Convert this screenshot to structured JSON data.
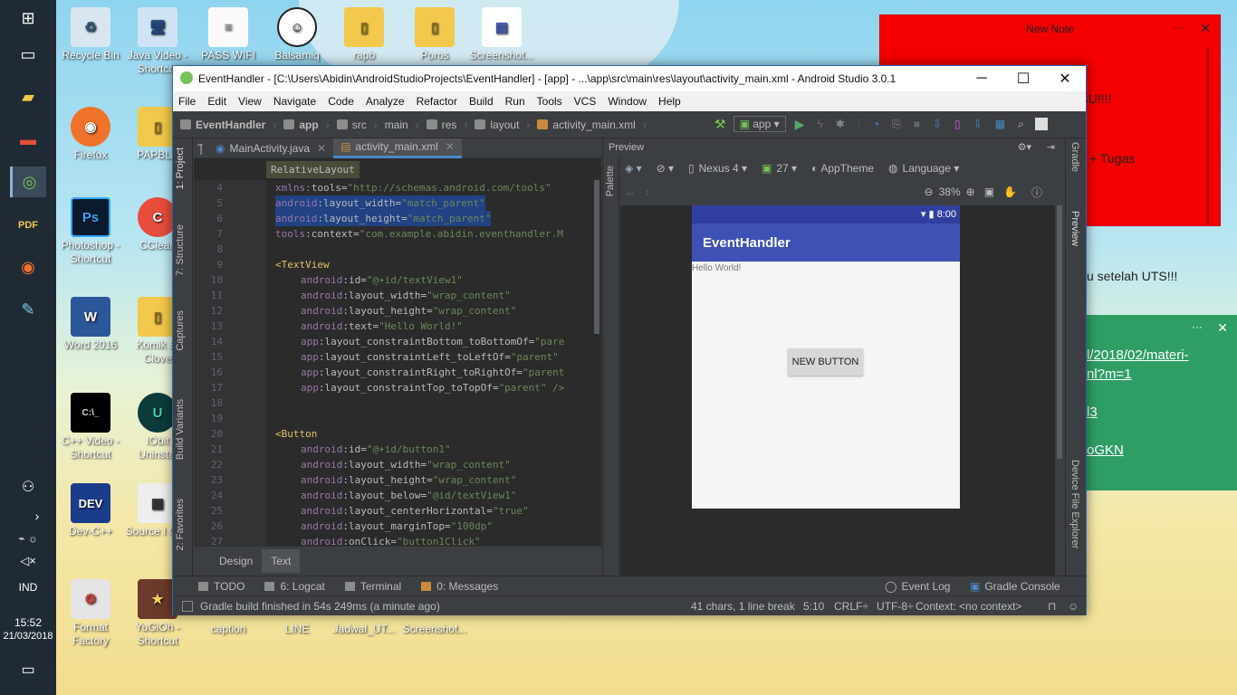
{
  "desktop": {
    "icons": [
      {
        "label": "Recycle Bin"
      },
      {
        "label": "Java Video - Shortcut"
      },
      {
        "label": "PASS WIFI"
      },
      {
        "label": "Balsamiq"
      },
      {
        "label": "rapb"
      },
      {
        "label": "Poros"
      },
      {
        "label": "Screenshot..."
      },
      {
        "label": "Firefox"
      },
      {
        "label": "PAPBLA"
      },
      {
        "label": "Photoshop - Shortcut"
      },
      {
        "label": "CClean"
      },
      {
        "label": "Word 2016"
      },
      {
        "label": "Komik Bl Clove"
      },
      {
        "label": "C++ Video - Shortcut"
      },
      {
        "label": "IObit Uninstal"
      },
      {
        "label": "Dev-C++"
      },
      {
        "label": "Source I C++"
      },
      {
        "label": "Format Factory"
      },
      {
        "label": "YuGiOh - Shortcut"
      },
      {
        "label": "caption"
      },
      {
        "label": "LINE"
      },
      {
        "label": "Jadwal_UT..."
      },
      {
        "label": "Screenshot..."
      }
    ]
  },
  "taskbar": {
    "language": "IND",
    "time": "15:52",
    "date": "21/03/2018"
  },
  "note_red": {
    "title": "New Note",
    "lines": [
      "-TUGAS METPEN DEADLINE RABU!!!!",
      "L + Tugas",
      "",
      "u setelah UTS!!!"
    ]
  },
  "note_green": {
    "links": [
      "l/2018/02/materi-",
      "nl?m=1",
      "l3",
      "oGKN"
    ]
  },
  "studio": {
    "window_title": "EventHandler - [C:\\Users\\Abidin\\AndroidStudioProjects\\EventHandler] - [app] - ...\\app\\src\\main\\res\\layout\\activity_main.xml - Android Studio 3.0.1",
    "menu": [
      "File",
      "Edit",
      "View",
      "Navigate",
      "Code",
      "Analyze",
      "Refactor",
      "Build",
      "Run",
      "Tools",
      "VCS",
      "Window",
      "Help"
    ],
    "breadcrumbs": [
      "EventHandler",
      "app",
      "src",
      "main",
      "res",
      "layout",
      "activity_main.xml"
    ],
    "run_config": "app",
    "tabs": [
      {
        "label": "MainActivity.java"
      },
      {
        "label": "activity_main.xml"
      }
    ],
    "left_tools": [
      "1: Project",
      "7: Structure",
      "Captures",
      "Build Variants",
      "2: Favorites"
    ],
    "right_tools": [
      "Gradle",
      "Preview",
      "Device File Explorer"
    ],
    "editor_breadcrumb": "RelativeLayout",
    "code_lines": [
      {
        "n": "4",
        "a": "xmlns:",
        "b": "tools",
        "c": "=",
        "d": "\"http://schemas.android.com/tools\""
      },
      {
        "n": "5",
        "a": "android",
        "b": ":layout_width",
        "c": "=",
        "d": "\"match_parent\""
      },
      {
        "n": "6",
        "a": "android",
        "b": ":layout_height",
        "c": "=",
        "d": "\"match_parent\""
      },
      {
        "n": "7",
        "a": "tools",
        "b": ":context",
        "c": "=",
        "d": "\"com.example.abidin.eventhandler.M"
      },
      {
        "n": "8",
        "a": "",
        "b": "",
        "c": "",
        "d": ""
      },
      {
        "n": "9",
        "a": "<TextView",
        "b": "",
        "c": "",
        "d": ""
      },
      {
        "n": "10",
        "a": "android",
        "b": ":id",
        "c": "=",
        "d": "\"@+id/textView1\""
      },
      {
        "n": "11",
        "a": "android",
        "b": ":layout_width",
        "c": "=",
        "d": "\"wrap_content\""
      },
      {
        "n": "12",
        "a": "android",
        "b": ":layout_height",
        "c": "=",
        "d": "\"wrap_content\""
      },
      {
        "n": "13",
        "a": "android",
        "b": ":text",
        "c": "=",
        "d": "\"Hello World!\""
      },
      {
        "n": "14",
        "a": "app",
        "b": ":layout_constraintBottom_toBottomOf",
        "c": "=",
        "d": "\"pare"
      },
      {
        "n": "15",
        "a": "app",
        "b": ":layout_constraintLeft_toLeftOf",
        "c": "=",
        "d": "\"parent\""
      },
      {
        "n": "16",
        "a": "app",
        "b": ":layout_constraintRight_toRightOf",
        "c": "=",
        "d": "\"parent"
      },
      {
        "n": "17",
        "a": "app",
        "b": ":layout_constraintTop_toTopOf",
        "c": "=",
        "d": "\"parent\" />"
      },
      {
        "n": "18",
        "a": "",
        "b": "",
        "c": "",
        "d": ""
      },
      {
        "n": "19",
        "a": "",
        "b": "",
        "c": "",
        "d": ""
      },
      {
        "n": "20",
        "a": "<Button",
        "b": "",
        "c": "",
        "d": ""
      },
      {
        "n": "21",
        "a": "android",
        "b": ":id",
        "c": "=",
        "d": "\"@+id/button1\""
      },
      {
        "n": "22",
        "a": "android",
        "b": ":layout_width",
        "c": "=",
        "d": "\"wrap_content\""
      },
      {
        "n": "23",
        "a": "android",
        "b": ":layout_height",
        "c": "=",
        "d": "\"wrap_content\""
      },
      {
        "n": "24",
        "a": "android",
        "b": ":layout_below",
        "c": "=",
        "d": "\"@id/textView1\""
      },
      {
        "n": "25",
        "a": "android",
        "b": ":layout_centerHorizontal",
        "c": "=",
        "d": "\"true\""
      },
      {
        "n": "26",
        "a": "android",
        "b": ":layout_marginTop",
        "c": "=",
        "d": "\"100dp\""
      },
      {
        "n": "27",
        "a": "android",
        "b": ":onClick",
        "c": "=",
        "d": "\"button1Click\""
      }
    ],
    "design_tabs": [
      "Design",
      "Text"
    ],
    "preview": {
      "title": "Preview",
      "palette_label": "Palette",
      "device": "Nexus 4",
      "api": "27",
      "theme": "AppTheme",
      "language": "Language",
      "zoom": "38%",
      "device_time": "8:00",
      "app_title": "EventHandler",
      "hello_text": "Hello World!",
      "button_text": "NEW BUTTON"
    },
    "tool_windows": [
      "TODO",
      "6: Logcat",
      "Terminal",
      "0: Messages"
    ],
    "tool_windows_right": [
      "Event Log",
      "Gradle Console"
    ],
    "status_message": "Gradle build finished in 54s 249ms (a minute ago)",
    "status_right": [
      "41 chars, 1 line break",
      "5:10",
      "CRLF÷",
      "UTF-8÷",
      "Context: <no context>"
    ]
  },
  "colors": {
    "accent_blue": "#3f51b5",
    "note_red": "#f50000",
    "note_green": "#2f9e65"
  }
}
